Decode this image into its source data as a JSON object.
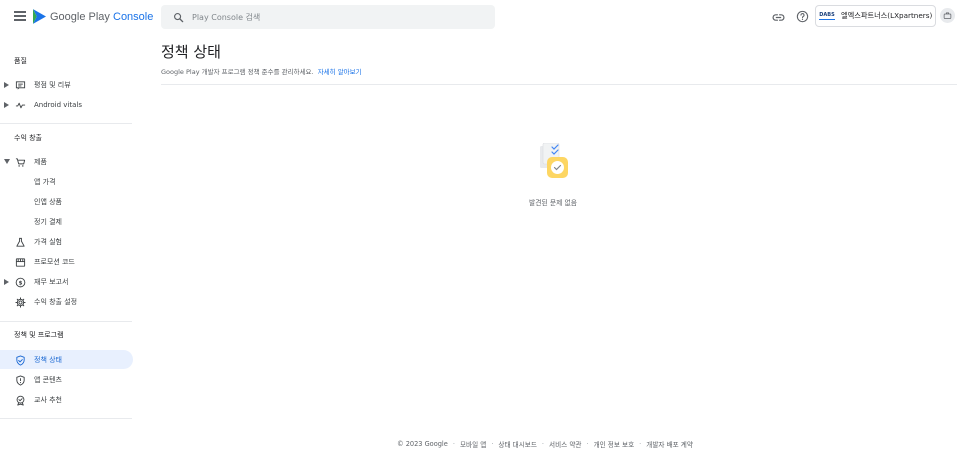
{
  "topbar": {
    "brand_prefix": "Google Play",
    "brand_accent": "Console",
    "search_placeholder": "Play Console 검색",
    "account_logo_text": "DABS",
    "account_name": "엘엑스파트너스(LXpartners)"
  },
  "sidebar": {
    "sections": [
      {
        "header": "품질"
      },
      {
        "header": "수익 창출"
      },
      {
        "header": "정책 및 프로그램"
      }
    ],
    "items": {
      "ratings_reviews": "평점 및 리뷰",
      "android_vitals": "Android vitals",
      "products": "제품",
      "app_pricing": "앱 가격",
      "in_app_products": "인앱 상품",
      "subscriptions": "정기 결제",
      "price_experiments": "가격 실험",
      "promo_codes": "프로모션 코드",
      "financial_reports": "재무 보고서",
      "monetization_setup": "수익 창출 설정",
      "policy_status": "정책 상태",
      "app_content": "앱 콘텐츠",
      "teacher_approved": "교사 추천"
    }
  },
  "main": {
    "title": "정책 상태",
    "description": "Google Play 개발자 프로그램 정책 준수를 관리하세요.",
    "learn_more": "자세히 알아보기",
    "empty_state": "발견된 문제 없음"
  },
  "footer": {
    "links": [
      "© 2023 Google",
      "모바일 앱",
      "상태 대시보드",
      "서비스 약관",
      "개인 정보 보호",
      "개발자 배포 계약"
    ]
  },
  "colors": {
    "accent": "#1a73e8",
    "active_bg": "#e8f0fe",
    "illustration_yellow": "#fdd663"
  }
}
